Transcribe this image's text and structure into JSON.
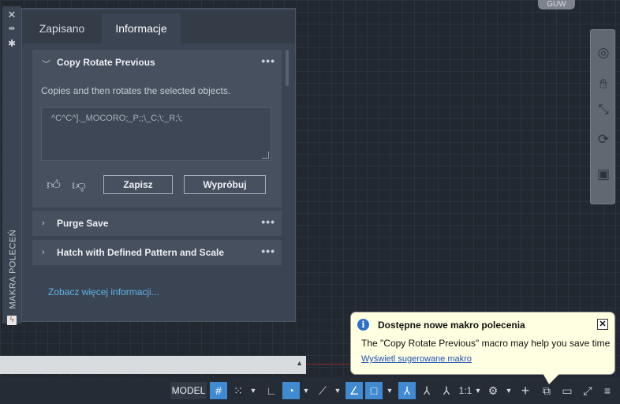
{
  "palette": {
    "strip": {
      "close_icon": "close-icon",
      "pin_icon": "pin-icon",
      "settings_icon": "gear-icon",
      "title": "MAKRA POLECEŃ"
    },
    "tabs": [
      {
        "label": "Zapisano"
      },
      {
        "label": "Informacje"
      }
    ],
    "active_tab": "Informacje",
    "cards": [
      {
        "title": "Copy Rotate Previous",
        "expanded": true,
        "description": "Copies and then rotates the selected objects.",
        "macro": "^C^C^]._MOCORO;_P;;\\_C;\\;_R;\\;",
        "save_label": "Zapisz",
        "try_label": "Wypróbuj"
      },
      {
        "title": "Purge Save",
        "expanded": false
      },
      {
        "title": "Hatch with Defined Pattern and Scale",
        "expanded": false
      }
    ],
    "see_more_link": "Zobacz więcej informacji..."
  },
  "viewcube": {
    "label": "GUW"
  },
  "statusbar": {
    "model_label": "MODEL",
    "scale_label": "1:1"
  },
  "notification": {
    "title": "Dostępne nowe makro polecenia",
    "body": "The \"Copy Rotate Previous\" macro may help you save time",
    "link": "Wyświetl sugerowane makro"
  },
  "colors": {
    "accent": "#3f8ad1",
    "link": "#5fb5ea",
    "balloon_bg": "#ffffe1"
  }
}
